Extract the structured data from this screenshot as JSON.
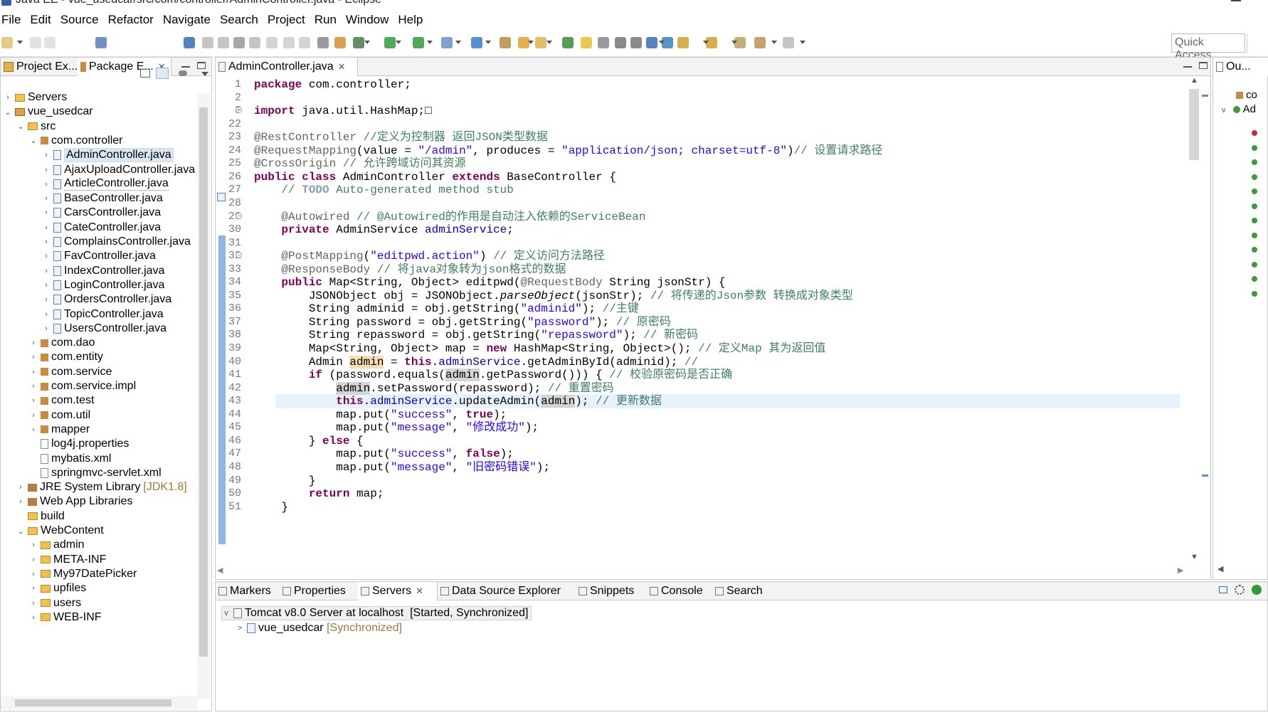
{
  "window": {
    "title": "Java EE - vue_usedcar/src/com/controller/AdminController.java - Eclipse"
  },
  "menu": [
    "File",
    "Edit",
    "Source",
    "Refactor",
    "Navigate",
    "Search",
    "Project",
    "Run",
    "Window",
    "Help"
  ],
  "quick_access": {
    "placeholder": "Quick Access"
  },
  "left_panel": {
    "tabs": [
      {
        "label": "Project Ex..."
      },
      {
        "label": "Package E..."
      }
    ],
    "tree": [
      {
        "label": "Servers",
        "depth": 0,
        "twisty": ">",
        "icon": "folder-icon"
      },
      {
        "label": "vue_usedcar",
        "depth": 0,
        "twisty": "v",
        "icon": "project-icon"
      },
      {
        "label": "src",
        "depth": 1,
        "twisty": "v",
        "icon": "source-folder-icon"
      },
      {
        "label": "com.controller",
        "depth": 2,
        "twisty": "v",
        "icon": "package-icon"
      },
      {
        "label": "AdminController.java",
        "depth": 3,
        "twisty": ">",
        "icon": "java-file-icon",
        "selected": true
      },
      {
        "label": "AjaxUploadController.java",
        "depth": 3,
        "twisty": ">",
        "icon": "java-file-icon"
      },
      {
        "label": "ArticleController.java",
        "depth": 3,
        "twisty": ">",
        "icon": "java-file-icon",
        "boxed": true
      },
      {
        "label": "BaseController.java",
        "depth": 3,
        "twisty": ">",
        "icon": "java-file-icon"
      },
      {
        "label": "CarsController.java",
        "depth": 3,
        "twisty": ">",
        "icon": "java-file-icon"
      },
      {
        "label": "CateController.java",
        "depth": 3,
        "twisty": ">",
        "icon": "java-file-icon"
      },
      {
        "label": "ComplainsController.java",
        "depth": 3,
        "twisty": ">",
        "icon": "java-file-icon"
      },
      {
        "label": "FavController.java",
        "depth": 3,
        "twisty": ">",
        "icon": "java-file-icon"
      },
      {
        "label": "IndexController.java",
        "depth": 3,
        "twisty": ">",
        "icon": "java-file-icon"
      },
      {
        "label": "LoginController.java",
        "depth": 3,
        "twisty": ">",
        "icon": "java-file-icon"
      },
      {
        "label": "OrdersController.java",
        "depth": 3,
        "twisty": ">",
        "icon": "java-file-icon"
      },
      {
        "label": "TopicController.java",
        "depth": 3,
        "twisty": ">",
        "icon": "java-file-icon"
      },
      {
        "label": "UsersController.java",
        "depth": 3,
        "twisty": ">",
        "icon": "java-file-icon"
      },
      {
        "label": "com.dao",
        "depth": 2,
        "twisty": ">",
        "icon": "package-icon"
      },
      {
        "label": "com.entity",
        "depth": 2,
        "twisty": ">",
        "icon": "package-icon"
      },
      {
        "label": "com.service",
        "depth": 2,
        "twisty": ">",
        "icon": "package-icon"
      },
      {
        "label": "com.service.impl",
        "depth": 2,
        "twisty": ">",
        "icon": "package-icon"
      },
      {
        "label": "com.test",
        "depth": 2,
        "twisty": ">",
        "icon": "package-icon"
      },
      {
        "label": "com.util",
        "depth": 2,
        "twisty": ">",
        "icon": "package-icon"
      },
      {
        "label": "mapper",
        "depth": 2,
        "twisty": ">",
        "icon": "package-icon"
      },
      {
        "label": "log4j.properties",
        "depth": 2,
        "twisty": "",
        "icon": "properties-file-icon"
      },
      {
        "label": "mybatis.xml",
        "depth": 2,
        "twisty": "",
        "icon": "xml-file-icon"
      },
      {
        "label": "springmvc-servlet.xml",
        "depth": 2,
        "twisty": "",
        "icon": "xml-file-icon"
      },
      {
        "label": "JRE System Library",
        "suffix": "[JDK1.8]",
        "depth": 1,
        "twisty": ">",
        "icon": "library-icon"
      },
      {
        "label": "Web App Libraries",
        "depth": 1,
        "twisty": ">",
        "icon": "library-icon"
      },
      {
        "label": "build",
        "depth": 1,
        "twisty": "",
        "icon": "folder-icon"
      },
      {
        "label": "WebContent",
        "depth": 1,
        "twisty": "v",
        "icon": "folder-icon"
      },
      {
        "label": "admin",
        "depth": 2,
        "twisty": ">",
        "icon": "folder-icon"
      },
      {
        "label": "META-INF",
        "depth": 2,
        "twisty": ">",
        "icon": "folder-icon"
      },
      {
        "label": "My97DatePicker",
        "depth": 2,
        "twisty": ">",
        "icon": "folder-icon"
      },
      {
        "label": "upfiles",
        "depth": 2,
        "twisty": ">",
        "icon": "folder-icon"
      },
      {
        "label": "users",
        "depth": 2,
        "twisty": ">",
        "icon": "folder-icon"
      },
      {
        "label": "WEB-INF",
        "depth": 2,
        "twisty": ">",
        "icon": "folder-icon"
      }
    ]
  },
  "editor": {
    "tab_label": "AdminController.java",
    "lines": [
      {
        "n": "1",
        "html": "<span class='kw'>package</span> com.controller;"
      },
      {
        "n": "2",
        "html": ""
      },
      {
        "n": "3",
        "html": "<span class='kw'>import</span> java.util.HashMap;&#9633;"
      },
      {
        "n": "22",
        "html": ""
      },
      {
        "n": "23",
        "html": "<span class='an'>@RestController</span> <span class='cm'>//定义为控制器 返回JSON类型数据</span>"
      },
      {
        "n": "24",
        "html": "<span class='an'>@RequestMapping</span>(value = <span class='st'>\"/admin\"</span>, produces = <span class='st'>\"application/json; charset=utf-8\"</span>)<span class='cm'>// 设置请求路径</span>"
      },
      {
        "n": "25",
        "html": "<span class='an'>@CrossOrigin</span> <span class='cm'>// 允许跨域访问其资源</span>"
      },
      {
        "n": "26",
        "html": "<span class='kw'>public</span> <span class='kw'>class</span> AdminController <span class='kw'>extends</span> BaseController {"
      },
      {
        "n": "27",
        "html": "    <span class='cm'>// <span class='todo'>TODO</span> Auto-generated method stub</span>"
      },
      {
        "n": "28",
        "html": ""
      },
      {
        "n": "29",
        "html": "    <span class='an'>@Autowired</span> <span class='cm'>// @Autowired的作用是自动注入依赖的ServiceBean</span>"
      },
      {
        "n": "30",
        "html": "    <span class='kw'>private</span> AdminService <span class='fd'>adminService</span>;"
      },
      {
        "n": "31",
        "html": ""
      },
      {
        "n": "32",
        "html": "    <span class='an'>@PostMapping</span>(<span class='st'>\"editpwd.action\"</span>) <span class='cm'>// 定义访问方法路径</span>"
      },
      {
        "n": "33",
        "html": "    <span class='an'>@ResponseBody</span> <span class='cm'>// 将java对象转为json格式的数据</span>"
      },
      {
        "n": "34",
        "html": "    <span class='kw'>public</span> Map&lt;String, Object&gt; editpwd(<span class='an'>@RequestBody</span> String jsonStr) {"
      },
      {
        "n": "35",
        "html": "        JSONObject obj = JSONObject.<i>parseObject</i>(jsonStr); <span class='cm'>// 将传递的Json参数 转换成对象类型</span>"
      },
      {
        "n": "36",
        "html": "        String adminid = obj.getString(<span class='st'>\"adminid\"</span>); <span class='cm'>//主键</span>"
      },
      {
        "n": "37",
        "html": "        String password = obj.getString(<span class='st'>\"password\"</span>); <span class='cm'>// 原密码</span>"
      },
      {
        "n": "38",
        "html": "        String repassword = obj.getString(<span class='st'>\"repassword\"</span>); <span class='cm'>// 新密码</span>"
      },
      {
        "n": "39",
        "html": "        Map&lt;String, Object&gt; map = <span class='kw'>new</span> HashMap&lt;String, Object&gt;(); <span class='cm'>// 定义Map 其为返回值</span>"
      },
      {
        "n": "40",
        "html": "        Admin <span class='occw'>admin</span> = <span class='kw'>this</span>.<span class='fd'>adminService</span>.getAdminById(adminid); <span class='cm'>//</span>"
      },
      {
        "n": "41",
        "html": "        <span class='kw'>if</span> (password.equals(<span class='occ'>admin</span>.getPassword())) { <span class='cm'>// 校验原密码是否正确</span>"
      },
      {
        "n": "42",
        "html": "            <span class='occ'>admin</span>.setPassword(repassword); <span class='cm'>// 重置密码</span>"
      },
      {
        "n": "43",
        "html": "            <span class='kw'>this</span>.<span class='fd'>adminService</span>.updateAdmin(<span class='occ'>admin</span>); <span class='cm'>// 更新数据</span>"
      },
      {
        "n": "44",
        "html": "            map.put(<span class='st'>\"success\"</span>, <span class='kw'>true</span>);"
      },
      {
        "n": "45",
        "html": "            map.put(<span class='st'>\"message\"</span>, <span class='st'>\"修改成功\"</span>);"
      },
      {
        "n": "46",
        "html": "        } <span class='kw'>else</span> {"
      },
      {
        "n": "47",
        "html": "            map.put(<span class='st'>\"success\"</span>, <span class='kw'>false</span>);"
      },
      {
        "n": "48",
        "html": "            map.put(<span class='st'>\"message\"</span>, <span class='st'>\"旧密码错误\"</span>);"
      },
      {
        "n": "49",
        "html": "        }"
      },
      {
        "n": "50",
        "html": "        <span class='kw'>return</span> map;"
      },
      {
        "n": "51",
        "html": "    }"
      }
    ]
  },
  "outline": {
    "tab_label": "Ou...",
    "items": [
      "co",
      "Ad"
    ]
  },
  "bottom_panel": {
    "tabs": [
      {
        "label": "Markers",
        "icon": "markers-icon"
      },
      {
        "label": "Properties",
        "icon": "properties-icon"
      },
      {
        "label": "Servers",
        "icon": "servers-icon",
        "active": true
      },
      {
        "label": "Data Source Explorer",
        "icon": "data-source-icon"
      },
      {
        "label": "Snippets",
        "icon": "snippets-icon"
      },
      {
        "label": "Console",
        "icon": "console-icon"
      },
      {
        "label": "Search",
        "icon": "search-icon"
      }
    ],
    "server": {
      "name": "Tomcat v8.0 Server at localhost",
      "status": "[Started, Synchronized]"
    },
    "module": {
      "name": "vue_usedcar",
      "status": "[Synchronized]"
    }
  }
}
